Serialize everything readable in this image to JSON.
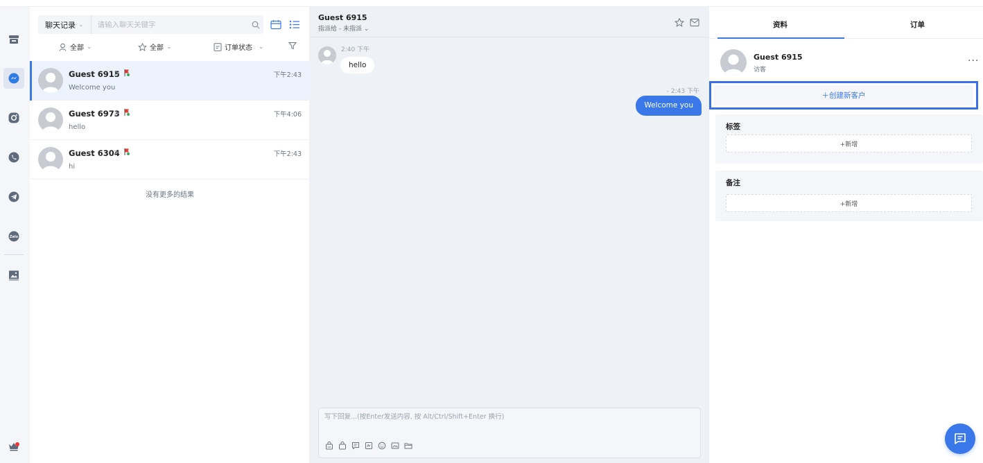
{
  "search": {
    "scope_label": "聊天记录",
    "placeholder": "请输入聊天关键字"
  },
  "filters": {
    "assignee_label": "全部",
    "star_label": "全部",
    "order_status_label": "订单状态"
  },
  "conversations": [
    {
      "name": "Guest 6915",
      "time": "下午2:43",
      "preview": "Welcome you",
      "selected": true
    },
    {
      "name": "Guest 6973",
      "time": "下午4:06",
      "preview": "hello",
      "selected": false
    },
    {
      "name": "Guest 6304",
      "time": "下午2:43",
      "preview": "hi",
      "selected": false
    }
  ],
  "no_more_label": "没有更多的结果",
  "chat": {
    "title": "Guest 6915",
    "assign_label": "指派给 - 未指派 ⌄",
    "messages": [
      {
        "direction": "in",
        "time": "2:40 下午",
        "text": "hello"
      },
      {
        "direction": "out",
        "time": "- 2:43 下午",
        "text": "Welcome you"
      }
    ],
    "composer_placeholder": "写下回复...(按Enter发送内容, 按 Alt/Ctrl/Shift+Enter 换行)"
  },
  "profile": {
    "tabs": [
      {
        "label": "资料",
        "active": true
      },
      {
        "label": "订单",
        "active": false
      }
    ],
    "name": "Guest 6915",
    "role": "访客",
    "create_customer_label": "＋创建新客户",
    "tags_title": "标签",
    "tags_add_label": "+新增",
    "notes_title": "备注",
    "notes_add_label": "+新增"
  },
  "rail_icons": [
    "store-icon",
    "messenger-icon",
    "instagram-icon",
    "whatsapp-icon",
    "telegram-icon",
    "zalo-icon",
    "gallery-icon",
    "crown-icon"
  ],
  "colors": {
    "accent": "#3a78ea",
    "highlight_border": "#3b6fe5",
    "selected_row": "#edf3fd",
    "notification_dot": "#e53935"
  }
}
